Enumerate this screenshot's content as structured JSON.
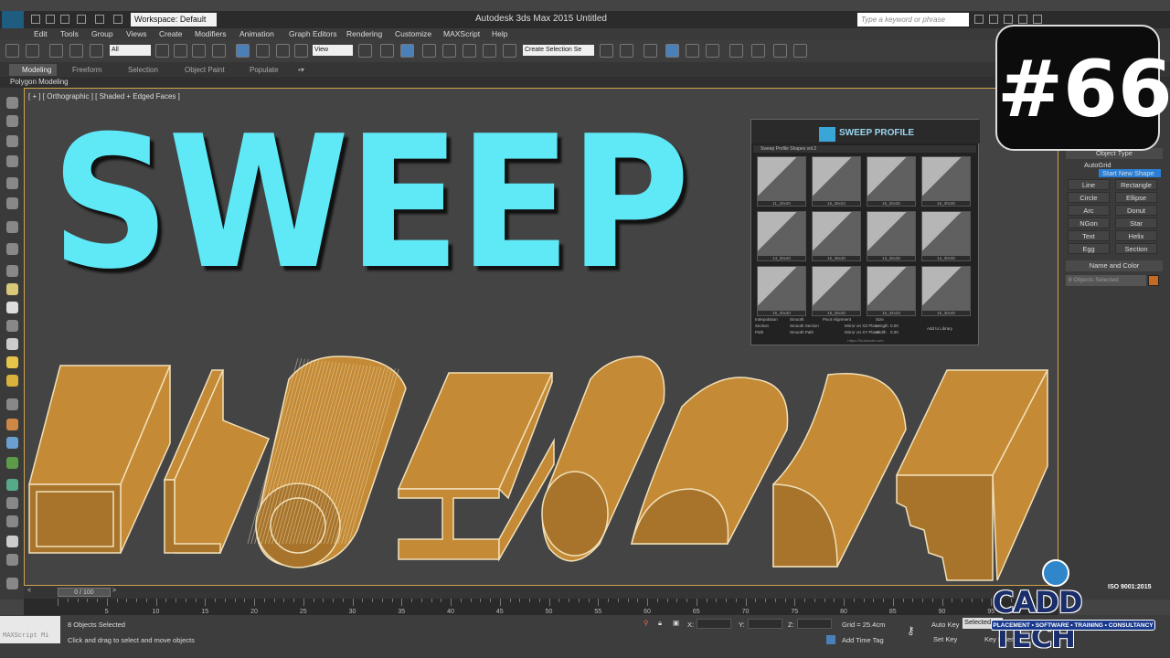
{
  "titlebar": {
    "workspace": "Workspace: Default",
    "title": "Autodesk 3ds Max  2015     Untitled",
    "search_placeholder": "Type a keyword or phrase"
  },
  "menu": [
    "Edit",
    "Tools",
    "Group",
    "Views",
    "Create",
    "Modifiers",
    "Animation",
    "Graph Editors",
    "Rendering",
    "Customize",
    "MAXScript",
    "Help"
  ],
  "toolbar": {
    "filter": "All",
    "refcoord": "View",
    "selection_set": "Create Selection Se"
  },
  "ribbon": {
    "tabs": [
      "Modeling",
      "Freeform",
      "Selection",
      "Object Paint",
      "Populate"
    ],
    "subtitle": "Polygon Modeling"
  },
  "viewport": {
    "label": "[ + ] [ Orthographic ] [ Shaded + Edged Faces ]",
    "overlay_title": "SWEEP",
    "shape_color": "#c48a36",
    "edge_color": "#f1e0b8"
  },
  "episode": "#66",
  "plugin": {
    "title": "SWEEP PROFILE",
    "library": "Sweep Profile Shapes vol.2",
    "thumbs": [
      "11_20x20",
      "16_36x34",
      "15_30x30",
      "16_30x30",
      "14_30x40",
      "10_36x40",
      "13_35x35",
      "14_30x30",
      "15_40x40",
      "16_26x40",
      "16_34x34",
      "16_30x40"
    ],
    "params": {
      "interpolation": "Interpolation",
      "section": "Section",
      "path": "Path",
      "smooth": "Smooth",
      "smooth_section": "Smooth Section",
      "smooth_path": "Smooth Path",
      "pivot_alignment": "Pivot Alignment",
      "mirror_xz": "Mirror on XZ Plane",
      "mirror_xy": "Mirror on XY Plane",
      "size": "Size",
      "length": "Length",
      "width": "Width",
      "length_val": "0.00",
      "width_val": "0.00",
      "add_library": "Add to Library"
    },
    "footer": "https://3d-kstudio.com"
  },
  "command_panel": {
    "object_type": "Object Type",
    "autogrid": "AutoGrid",
    "start_new_shape": "Start New Shape",
    "buttons": [
      "Line",
      "Rectangle",
      "Circle",
      "Ellipse",
      "Arc",
      "Donut",
      "NGon",
      "Star",
      "Text",
      "Helix",
      "Egg",
      "Section"
    ],
    "name_and_color": "Name and Color",
    "name_field": "8 Objects Selected",
    "color_swatch": "#c46a23"
  },
  "timeline": {
    "slider": "0 / 100",
    "ticks": [
      "5",
      "10",
      "15",
      "20",
      "25",
      "30",
      "35",
      "40",
      "45",
      "50",
      "55",
      "60",
      "65",
      "70",
      "75",
      "80",
      "85",
      "90",
      "95"
    ]
  },
  "status": {
    "maxscript": "MAXScript Mi",
    "selected": "8 Objects Selected",
    "prompt": "Click and drag to select and move objects",
    "x": "X:",
    "y": "Y:",
    "z": "Z:",
    "grid": "Grid = 25.4cm",
    "add_time_tag": "Add Time Tag",
    "auto_key": "Auto Key",
    "set_key": "Set Key",
    "selected_dd": "Selected",
    "key_filters": "Key Filters..."
  },
  "caddtech": {
    "name": "CADD TECH",
    "iso": "ISO 9001:2015",
    "tagline": "PLACEMENT • SOFTWARE • TRAINING • CONSULTANCY"
  }
}
